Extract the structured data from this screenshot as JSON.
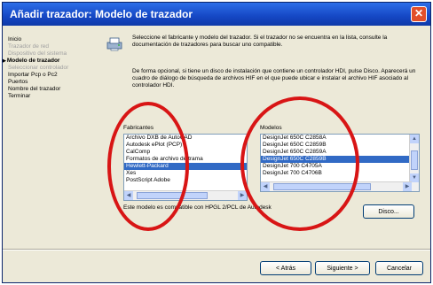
{
  "window": {
    "title": "Añadir trazador: Modelo de trazador",
    "close_glyph": "✕"
  },
  "side_nav": {
    "items": [
      {
        "label": "Inicio",
        "state": "normal"
      },
      {
        "label": "Trazador de red",
        "state": "disabled"
      },
      {
        "label": "Dispositivo del sistema",
        "state": "disabled"
      },
      {
        "label": "Modelo de trazador",
        "state": "active"
      },
      {
        "label": "Seleccionar controlador",
        "state": "disabled"
      },
      {
        "label": "Importar Pcp o Pc2",
        "state": "normal"
      },
      {
        "label": "Puertos",
        "state": "normal"
      },
      {
        "label": "Nombre del trazador",
        "state": "normal"
      },
      {
        "label": "Terminar",
        "state": "normal"
      }
    ]
  },
  "content": {
    "icon": "plotter-wizard-icon",
    "intro_text": "Seleccione el fabricante y modelo del trazador. Si el trazador no se encuentra en la lista, consulte la documentación de trazadores para buscar uno compatible.",
    "intro_text_2": "De forma opcional, si tiene un disco de instalación que contiene un controlador HDI, pulse Disco. Aparecerá un cuadro de diálogo de búsqueda de archivos HIF en el que puede ubicar e instalar el archivo HIF asociado al controlador HDI.",
    "manufacturers_label": "Fabricantes",
    "manufacturers": [
      {
        "label": "Archivo DXB de AutoCAD",
        "selected": false
      },
      {
        "label": "Autodesk ePlot (PCP)",
        "selected": false
      },
      {
        "label": "CalComp",
        "selected": false
      },
      {
        "label": "Formatos de archivo de trama",
        "selected": false
      },
      {
        "label": "Hewlett-Packard",
        "selected": true
      },
      {
        "label": "Xes",
        "selected": false
      },
      {
        "label": "PostScript Adobe",
        "selected": false
      }
    ],
    "models_label": "Modelos",
    "models": [
      {
        "label": "DesignJet 650C C2858A",
        "selected": false
      },
      {
        "label": "DesignJet 650C C2859B",
        "selected": false
      },
      {
        "label": "DesignJet 650C C2859A",
        "selected": false
      },
      {
        "label": "DesignJet 650C C2859B",
        "selected": true
      },
      {
        "label": "DesignJet 700 C4705A",
        "selected": false
      },
      {
        "label": "DesignJet 700 C4706B",
        "selected": false
      }
    ],
    "hint_text": "Este modelo es compatible con HPGL 2/PCL de Autodesk"
  },
  "buttons": {
    "disk": "Disco...",
    "back": "< Atrás",
    "next": "Siguiente >",
    "cancel": "Cancelar"
  },
  "colors": {
    "title_bar": "#1547c4",
    "selection": "#316ac5",
    "annotation": "#d81515"
  }
}
